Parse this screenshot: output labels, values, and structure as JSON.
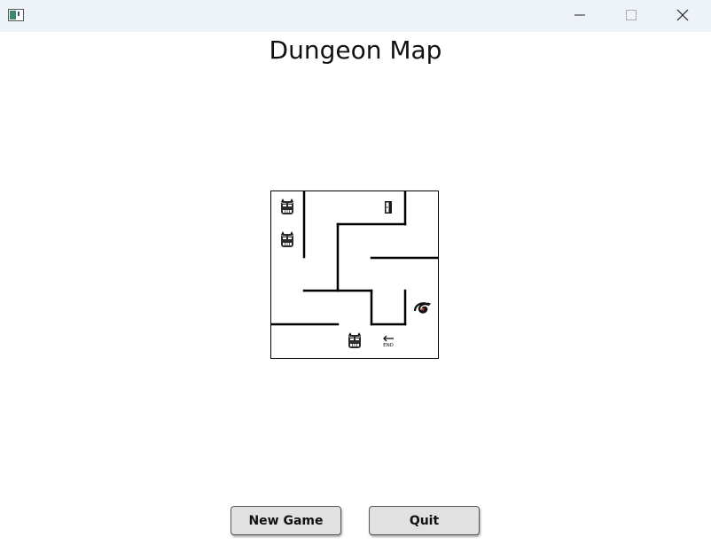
{
  "window": {
    "app_icon": "window-icon",
    "minimize_icon": "minimize-icon",
    "maximize_icon": "maximize-icon",
    "close_icon": "close-icon"
  },
  "page": {
    "title": "Dungeon Map"
  },
  "map": {
    "grid_size": 5,
    "cells": [
      {
        "row": 0,
        "col": 0,
        "content": "monster",
        "icon": "monster-icon"
      },
      {
        "row": 1,
        "col": 0,
        "content": "monster",
        "icon": "monster-icon"
      },
      {
        "row": 0,
        "col": 3,
        "content": "door",
        "icon": "door-icon"
      },
      {
        "row": 3,
        "col": 4,
        "content": "vortex",
        "icon": "vortex-icon"
      },
      {
        "row": 4,
        "col": 2,
        "content": "monster",
        "icon": "monster-icon"
      },
      {
        "row": 4,
        "col": 3,
        "content": "end",
        "icon": "end-arrow-icon",
        "label": "END"
      }
    ]
  },
  "buttons": {
    "new_game": "New Game",
    "quit": "Quit"
  }
}
